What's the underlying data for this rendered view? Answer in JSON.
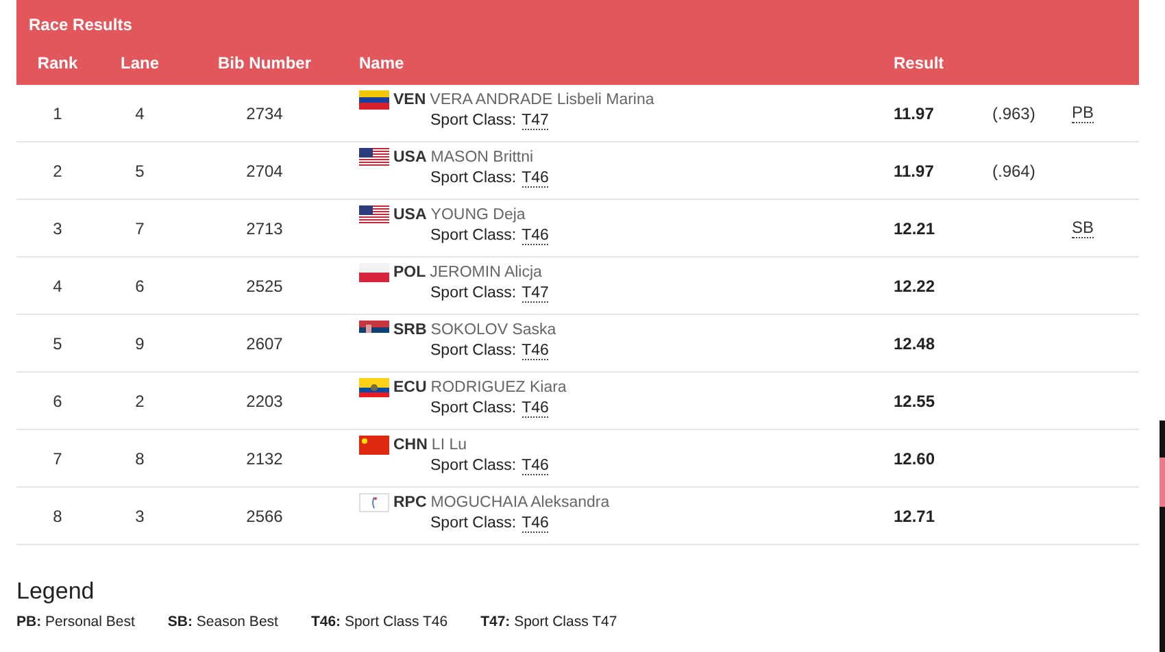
{
  "panel": {
    "title": "Race Results"
  },
  "columns": {
    "rank": "Rank",
    "lane": "Lane",
    "bib": "Bib Number",
    "name": "Name",
    "result": "Result"
  },
  "rows": [
    {
      "rank": "1",
      "lane": "4",
      "bib": "2734",
      "flag": {
        "kind": "venezuela"
      },
      "country": "VEN",
      "athlete": "VERA ANDRADE Lisbeli Marina",
      "class_label": "Sport Class:",
      "class": "T47",
      "result": "11.97",
      "tiebreak": "(.963)",
      "record": "PB"
    },
    {
      "rank": "2",
      "lane": "5",
      "bib": "2704",
      "flag": {
        "kind": "usa"
      },
      "country": "USA",
      "athlete": "MASON Brittni",
      "class_label": "Sport Class:",
      "class": "T46",
      "result": "11.97",
      "tiebreak": "(.964)"
    },
    {
      "rank": "3",
      "lane": "7",
      "bib": "2713",
      "flag": {
        "kind": "usa"
      },
      "country": "USA",
      "athlete": "YOUNG Deja",
      "class_label": "Sport Class:",
      "class": "T46",
      "result": "12.21",
      "record": "SB"
    },
    {
      "rank": "4",
      "lane": "6",
      "bib": "2525",
      "flag": {
        "kind": "poland"
      },
      "country": "POL",
      "athlete": "JEROMIN Alicja",
      "class_label": "Sport Class:",
      "class": "T47",
      "result": "12.22"
    },
    {
      "rank": "5",
      "lane": "9",
      "bib": "2607",
      "flag": {
        "kind": "serbia"
      },
      "country": "SRB",
      "athlete": "SOKOLOV Saska",
      "class_label": "Sport Class:",
      "class": "T46",
      "result": "12.48"
    },
    {
      "rank": "6",
      "lane": "2",
      "bib": "2203",
      "flag": {
        "kind": "ecuador"
      },
      "country": "ECU",
      "athlete": "RODRIGUEZ Kiara",
      "class_label": "Sport Class:",
      "class": "T46",
      "result": "12.55"
    },
    {
      "rank": "7",
      "lane": "8",
      "bib": "2132",
      "flag": {
        "kind": "china"
      },
      "country": "CHN",
      "athlete": "LI Lu",
      "class_label": "Sport Class:",
      "class": "T46",
      "result": "12.60"
    },
    {
      "rank": "8",
      "lane": "3",
      "bib": "2566",
      "flag": {
        "kind": "rpc"
      },
      "country": "RPC",
      "athlete": "MOGUCHAIA Aleksandra",
      "class_label": "Sport Class:",
      "class": "T46",
      "result": "12.71"
    }
  ],
  "legend": {
    "title": "Legend",
    "items": [
      {
        "key": "PB:",
        "text": "Personal Best"
      },
      {
        "key": "SB:",
        "text": "Season Best"
      },
      {
        "key": "T46:",
        "text": "Sport Class T46"
      },
      {
        "key": "T47:",
        "text": "Sport Class T47"
      }
    ]
  }
}
